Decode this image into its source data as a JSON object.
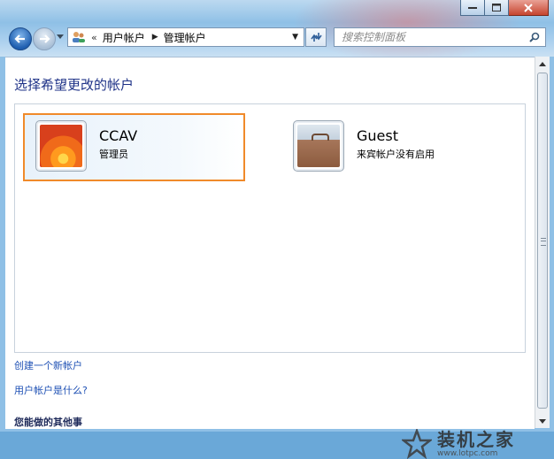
{
  "window": {
    "controls": {
      "minimize": "minimize",
      "maximize": "maximize",
      "close": "close"
    }
  },
  "nav": {
    "back_icon": "back-arrow-icon",
    "forward_icon": "forward-arrow-icon"
  },
  "address_bar": {
    "overflow": "«",
    "breadcrumbs": [
      "用户帐户",
      "管理帐户"
    ],
    "separator": "▶",
    "dropdown": "▼"
  },
  "search": {
    "placeholder": "搜索控制面板"
  },
  "main": {
    "heading": "选择希望更改的帐户",
    "accounts": [
      {
        "name": "CCAV",
        "role": "管理员",
        "picture": "orange-flower",
        "selected": true
      },
      {
        "name": "Guest",
        "role": "来宾帐户没有启用",
        "picture": "suitcase",
        "selected": false
      }
    ],
    "links": [
      "创建一个新帐户",
      "用户帐户是什么?"
    ],
    "subheading": "您能做的其他事"
  },
  "watermark": {
    "title": "装机之家",
    "url": "www.lotpc.com"
  },
  "colors": {
    "selection_border": "#f08a2a",
    "link": "#1e50b4",
    "heading": "#1e3287"
  }
}
